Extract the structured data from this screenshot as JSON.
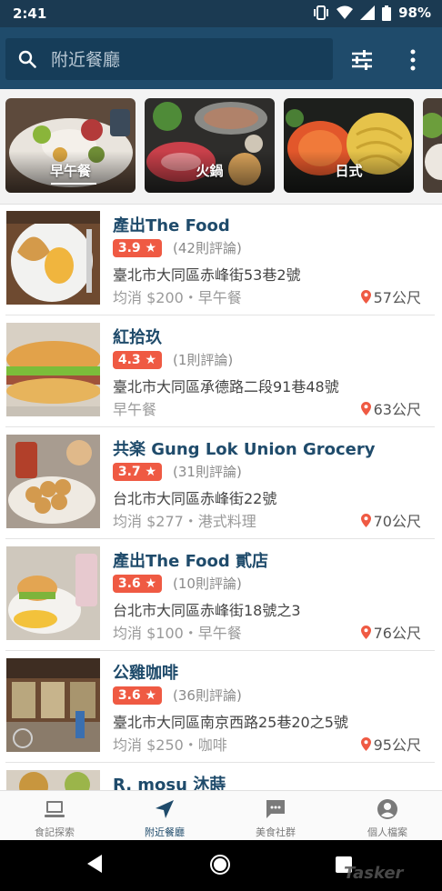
{
  "status_bar": {
    "time": "2:41",
    "battery": "98%"
  },
  "search": {
    "placeholder": "附近餐廳"
  },
  "categories": [
    {
      "label": "早午餐"
    },
    {
      "label": "火鍋"
    },
    {
      "label": "日式"
    }
  ],
  "restaurants": [
    {
      "name": "產出The Food",
      "rating": "3.9 ★",
      "reviews": "(42則評論)",
      "address": "臺北市大同區赤峰街53巷2號",
      "meta": "均消 $200・早午餐",
      "distance": "57公尺"
    },
    {
      "name": "紅拾玖",
      "rating": "4.3 ★",
      "reviews": "(1則評論)",
      "address": "臺北市大同區承德路二段91巷48號",
      "meta": "早午餐",
      "distance": "63公尺"
    },
    {
      "name": "共楽 Gung Lok Union Grocery",
      "rating": "3.7 ★",
      "reviews": "(31則評論)",
      "address": "台北市大同區赤峰街22號",
      "meta": "均消 $277・港式料理",
      "distance": "70公尺"
    },
    {
      "name": "產出The Food 貳店",
      "rating": "3.6 ★",
      "reviews": "(10則評論)",
      "address": "台北市大同區赤峰街18號之3",
      "meta": "均消 $100・早午餐",
      "distance": "76公尺"
    },
    {
      "name": "公雞咖啡",
      "rating": "3.6 ★",
      "reviews": "(36則評論)",
      "address": "臺北市大同區南京西路25巷20之5號",
      "meta": "均消 $250・咖啡",
      "distance": "95公尺"
    },
    {
      "name": "R. mosu 沐蒔",
      "rating": "",
      "reviews": "",
      "address": "",
      "meta": "",
      "distance": ""
    }
  ],
  "bottom_nav": [
    {
      "label": "食記探索"
    },
    {
      "label": "附近餐廳"
    },
    {
      "label": "美食社群"
    },
    {
      "label": "個人檔案"
    }
  ],
  "watermark": "Tasker",
  "colors": {
    "primary": "#1f4b6b",
    "accent": "#ef5a43",
    "status_bar": "#1b3a52"
  }
}
